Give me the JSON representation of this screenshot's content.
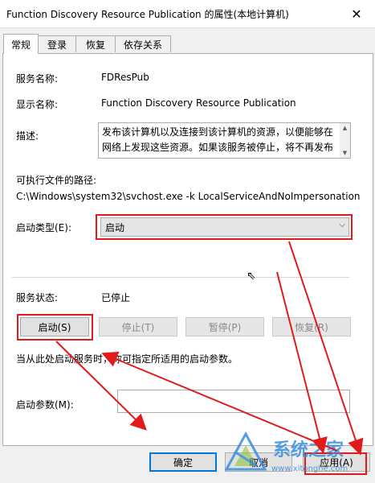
{
  "window": {
    "title": "Function Discovery Resource Publication 的属性(本地计算机)",
    "close_glyph": "✕"
  },
  "tabs": [
    {
      "label": "常规",
      "active": true
    },
    {
      "label": "登录",
      "active": false
    },
    {
      "label": "恢复",
      "active": false
    },
    {
      "label": "依存关系",
      "active": false
    }
  ],
  "general": {
    "service_name_label": "服务名称:",
    "service_name": "FDResPub",
    "display_name_label": "显示名称:",
    "display_name": "Function Discovery Resource Publication",
    "description_label": "描述:",
    "description": "发布该计算机以及连接到该计算机的资源，以便能够在网络上发现这些资源。如果该服务被停止，将不再发布",
    "path_label": "可执行文件的路径:",
    "path": "C:\\Windows\\system32\\svchost.exe -k LocalServiceAndNoImpersonation",
    "startup_type_label": "启动类型(E):",
    "startup_type": "启动",
    "status_label": "服务状态:",
    "status": "已停止",
    "buttons": {
      "start": "启动(S)",
      "stop": "停止(T)",
      "pause": "暂停(P)",
      "resume": "恢复(R)"
    },
    "hint": "当从此处启动服务时，你可指定所适用的启动参数。",
    "params_label": "启动参数(M):",
    "params_value": ""
  },
  "footer": {
    "ok": "确定",
    "cancel": "取消",
    "apply": "应用(A)"
  },
  "watermark": {
    "text": "系统之家",
    "url": "www.xitonghe.com"
  },
  "colors": {
    "highlight": "#e11b1b",
    "accent": "#0078d7"
  }
}
